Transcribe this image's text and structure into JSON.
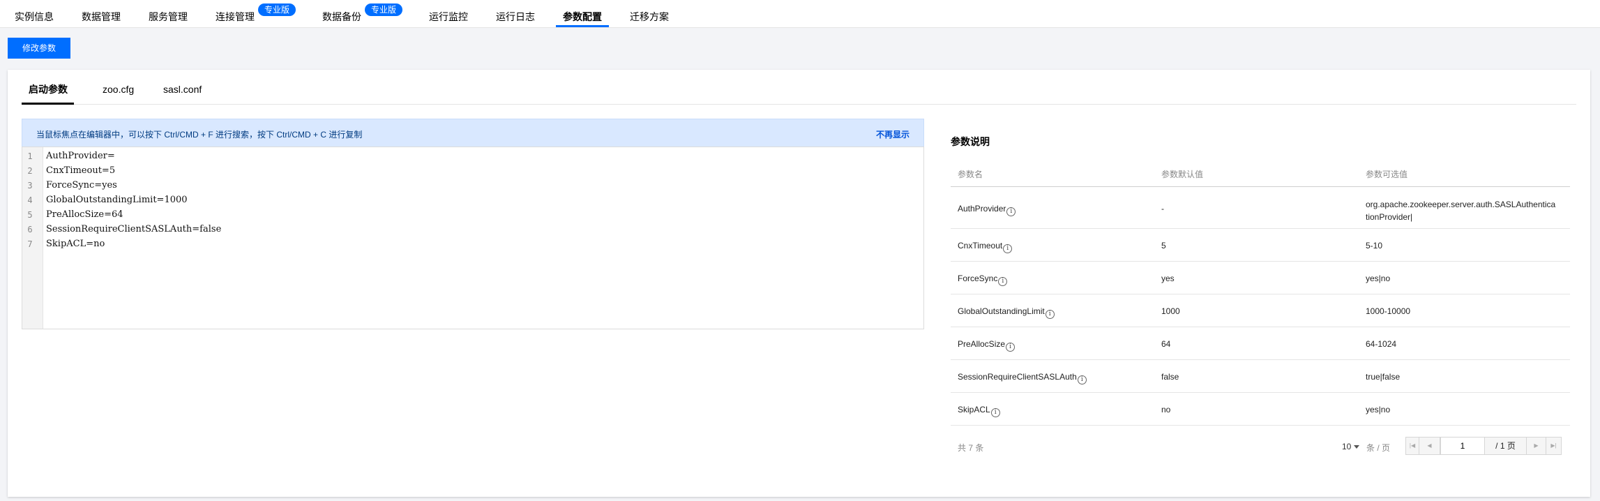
{
  "nav": {
    "items": [
      {
        "label": "实例信息"
      },
      {
        "label": "数据管理"
      },
      {
        "label": "服务管理"
      },
      {
        "label": "连接管理",
        "badge": "专业版"
      },
      {
        "label": "数据备份",
        "badge": "专业版"
      },
      {
        "label": "运行监控"
      },
      {
        "label": "运行日志"
      },
      {
        "label": "参数配置",
        "active": true
      },
      {
        "label": "迁移方案"
      }
    ]
  },
  "toolbar": {
    "edit_label": "修改参数"
  },
  "subtabs": [
    {
      "label": "启动参数",
      "active": true
    },
    {
      "label": "zoo.cfg"
    },
    {
      "label": "sasl.conf"
    }
  ],
  "editor": {
    "notice": "当鼠标焦点在编辑器中，可以按下 Ctrl/CMD + F 进行搜索，按下 Ctrl/CMD + C 进行复制",
    "dismiss": "不再显示",
    "line_numbers": [
      "1",
      "2",
      "3",
      "4",
      "5",
      "6",
      "7"
    ],
    "lines": [
      "AuthProvider=",
      "CnxTimeout=5",
      "ForceSync=yes",
      "GlobalOutstandingLimit=1000",
      "PreAllocSize=64",
      "SessionRequireClientSASLAuth=false",
      "SkipACL=no"
    ]
  },
  "params": {
    "title": "参数说明",
    "columns": [
      "参数名",
      "参数默认值",
      "参数可选值"
    ],
    "info_glyph": "i",
    "rows": [
      {
        "name": "AuthProvider",
        "default": "-",
        "options": [
          "org.apache.zookeeper.server.auth.SASLAuthentica",
          "tionProvider|"
        ]
      },
      {
        "name": "CnxTimeout",
        "default": "5",
        "options": [
          "5-10"
        ]
      },
      {
        "name": "ForceSync",
        "default": "yes",
        "options": [
          "yes|no"
        ]
      },
      {
        "name": "GlobalOutstandingLimit",
        "default": "1000",
        "options": [
          "1000-10000"
        ]
      },
      {
        "name": "PreAllocSize",
        "default": "64",
        "options": [
          "64-1024"
        ]
      },
      {
        "name": "SessionRequireClientSASLAuth",
        "default": "false",
        "options": [
          "true|false"
        ]
      },
      {
        "name": "SkipACL",
        "default": "no",
        "options": [
          "yes|no"
        ]
      }
    ]
  },
  "pagination": {
    "total_text": "共 7 条",
    "page_size": "10",
    "per_page_text": "条 / 页",
    "current_page": "1",
    "of_pages": "/ 1 页"
  }
}
